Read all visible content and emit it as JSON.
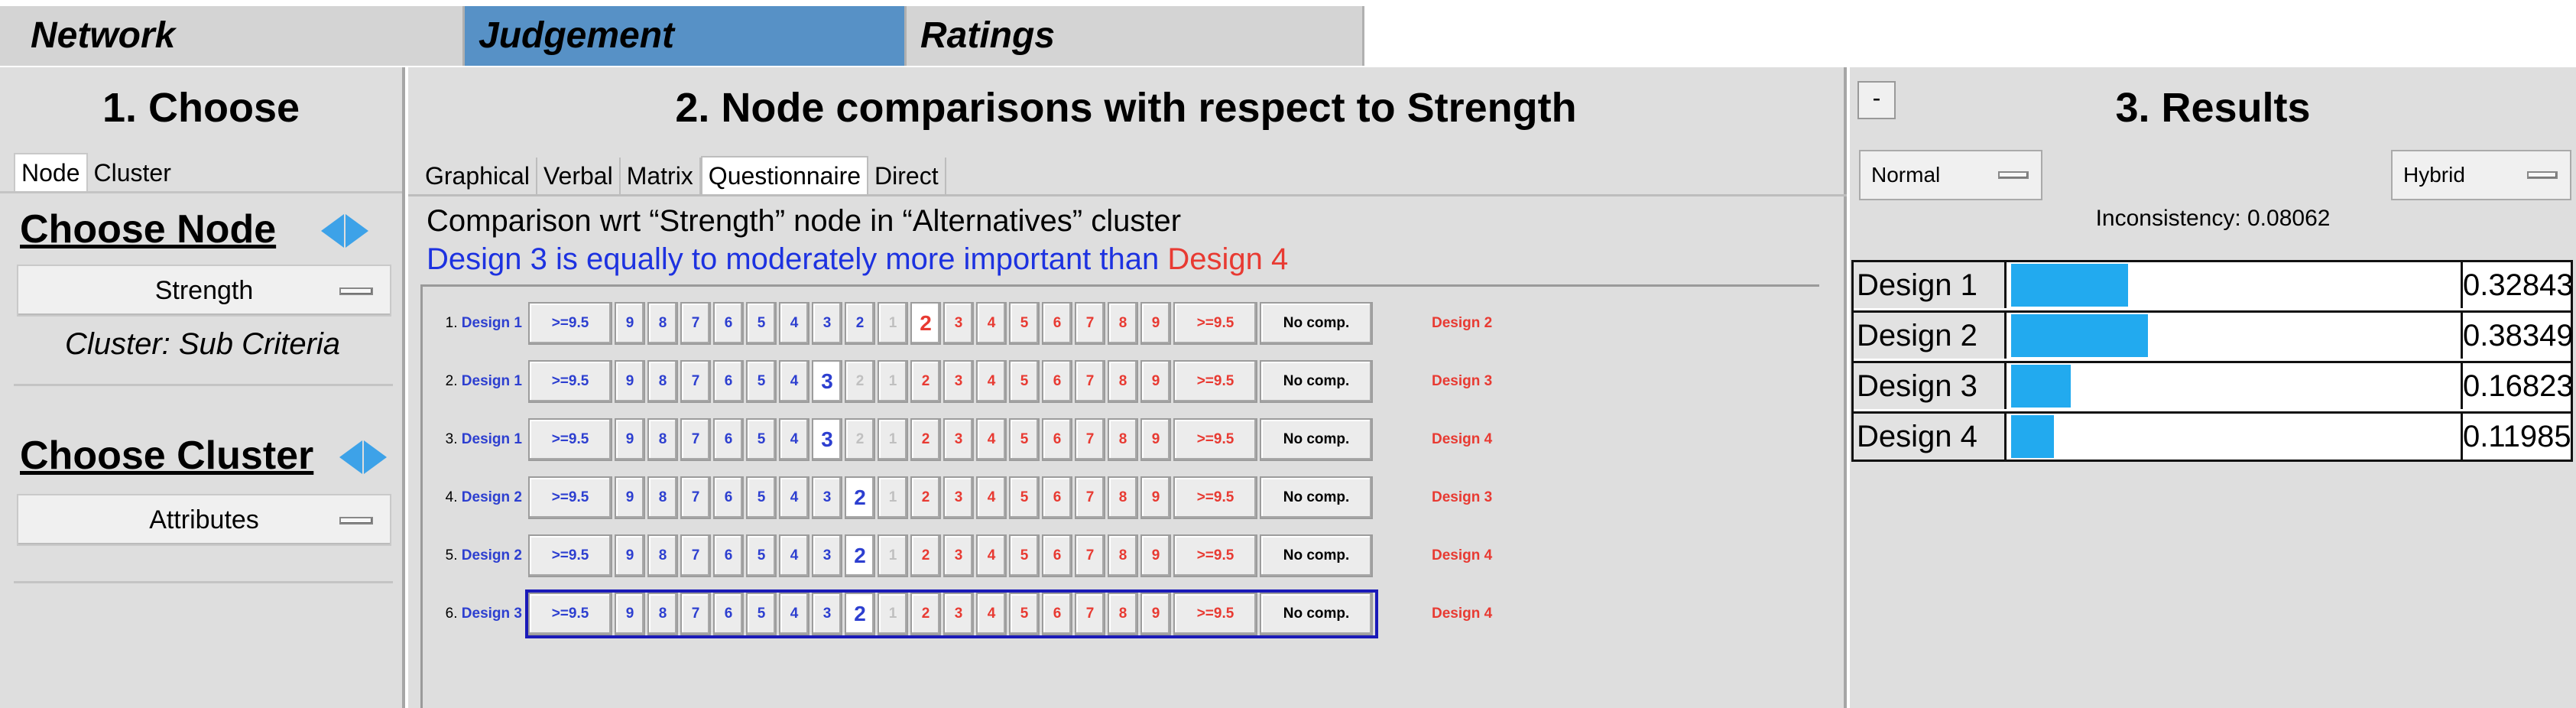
{
  "top_tabs": {
    "network": "Network",
    "judgement": "Judgement",
    "ratings": "Ratings"
  },
  "left": {
    "title": "1. Choose",
    "tab_node": "Node",
    "tab_cluster": "Cluster",
    "choose_node_label": "Choose Node",
    "node_value": "Strength",
    "cluster_info": "Cluster: Sub Criteria",
    "choose_cluster_label": "Choose Cluster",
    "cluster_value": "Attributes"
  },
  "mid": {
    "title": "2. Node comparisons with respect to Strength",
    "methods": [
      "Graphical",
      "Verbal",
      "Matrix",
      "Questionnaire",
      "Direct"
    ],
    "active_method": "Questionnaire",
    "comparison_text": "Comparison wrt “Strength” node in “Alternatives” cluster",
    "verbal_left": "Design 3 is equally to moderately more important than",
    "verbal_right": "Design 4",
    "scale_left": [
      ">=9.5",
      "9",
      "8",
      "7",
      "6",
      "5",
      "4",
      "3",
      "2",
      "1"
    ],
    "scale_right": [
      "2",
      "3",
      "4",
      "5",
      "6",
      "7",
      "8",
      "9",
      ">=9.5"
    ],
    "no_comp": "No comp.",
    "rows": [
      {
        "num": "1.",
        "left": "Design 1",
        "right": "Design 2",
        "selected": "R2"
      },
      {
        "num": "2.",
        "left": "Design 1",
        "right": "Design 3",
        "selected": "L3"
      },
      {
        "num": "3.",
        "left": "Design 1",
        "right": "Design 4",
        "selected": "L3"
      },
      {
        "num": "4.",
        "left": "Design 2",
        "right": "Design 3",
        "selected": "L2"
      },
      {
        "num": "5.",
        "left": "Design 2",
        "right": "Design 4",
        "selected": "L2"
      },
      {
        "num": "6.",
        "left": "Design 3",
        "right": "Design 4",
        "selected": "L2"
      }
    ]
  },
  "right": {
    "collapse_label": "-",
    "title": "3. Results",
    "normal_label": "Normal",
    "hybrid_label": "Hybrid",
    "inconsistency": "Inconsistency: 0.08062",
    "results": [
      {
        "name": "Design 1",
        "value": "0.32843",
        "fraction": 0.32843
      },
      {
        "name": "Design 2",
        "value": "0.38349",
        "fraction": 0.38349
      },
      {
        "name": "Design 3",
        "value": "0.16823",
        "fraction": 0.16823
      },
      {
        "name": "Design 4",
        "value": "0.11985",
        "fraction": 0.11985
      }
    ]
  },
  "colors": {
    "accent_tab": "#5791c6",
    "left_blue": "#1d32e0",
    "right_red": "#e83a32",
    "bar": "#22aaef"
  }
}
